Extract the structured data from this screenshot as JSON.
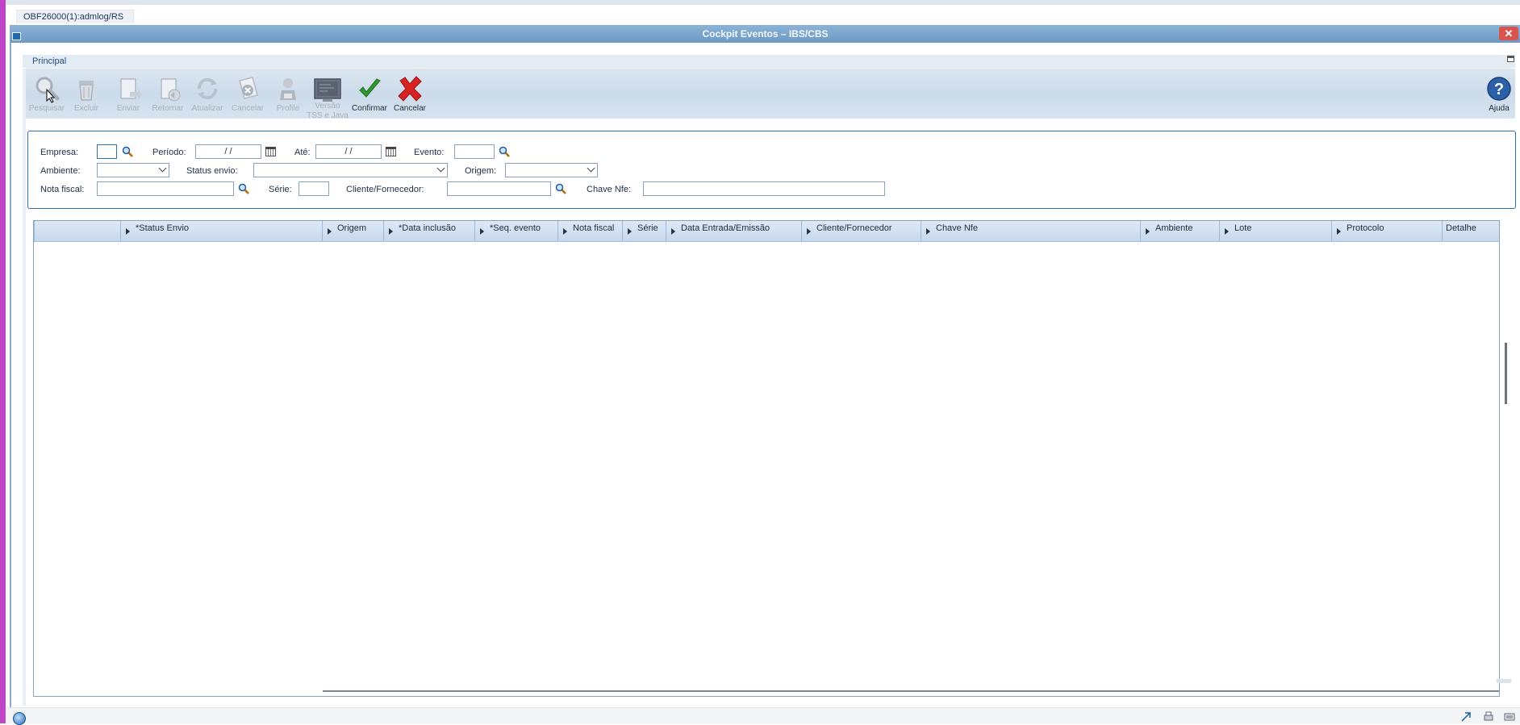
{
  "session": {
    "tab_label": "OBF26000(1):admlog/RS"
  },
  "window": {
    "title": "Cockpit Eventos – IBS/CBS",
    "close_symbol": "✕"
  },
  "tab": {
    "label": "Principal"
  },
  "toolbar": {
    "pesquisar": "Pesquisar",
    "excluir": "Excluir",
    "enviar": "Enviar",
    "retornar": "Retornar",
    "atualizar": "Atualizar",
    "cancelar_evento": "Cancelar",
    "profile": "Profile",
    "versao_line1": "Versão",
    "versao_line2": "TSS e Java",
    "confirmar": "Confirmar",
    "cancelar": "Cancelar",
    "ajuda": "Ajuda"
  },
  "filters": {
    "empresa_label": "Empresa:",
    "empresa_value": "",
    "periodo_label": "Período:",
    "periodo_value": " / /",
    "ate_label": "Até:",
    "ate_value": " / /",
    "evento_label": "Evento:",
    "evento_value": "",
    "ambiente_label": "Ambiente:",
    "ambiente_value": "",
    "status_envio_label": "Status envio:",
    "status_envio_value": "",
    "origem_label": "Origem:",
    "origem_value": "",
    "nota_fiscal_label": "Nota fiscal:",
    "nota_fiscal_value": "",
    "serie_label": "Série:",
    "serie_value": "",
    "cliente_label": "Cliente/Fornecedor:",
    "cliente_value": "",
    "chave_label": "Chave Nfe:",
    "chave_value": ""
  },
  "grid": {
    "columns": [
      "",
      "*Status Envio",
      "Origem",
      "*Data inclusão",
      "*Seq. evento",
      "Nota fiscal",
      "Série",
      "Data Entrada/Emissão",
      "Cliente/Fornecedor",
      "Chave Nfe",
      "Ambiente",
      "Lote",
      "Protocolo",
      "Detalhe"
    ],
    "rows": []
  },
  "colors": {
    "titlebar": "#7aa3cb",
    "toolbar": "#d3e0ed",
    "panel_border": "#2e6eb5",
    "confirm_green": "#2f9a2f",
    "cancel_red": "#d62222"
  }
}
